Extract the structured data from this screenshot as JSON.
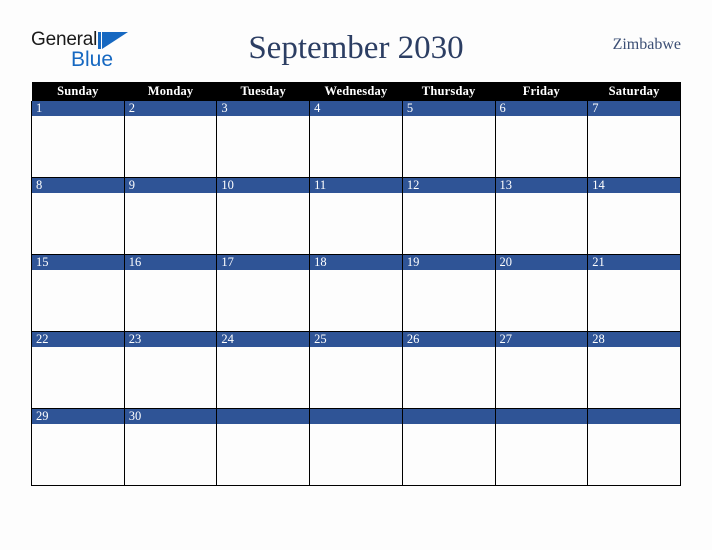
{
  "brand": {
    "name_part1": "General",
    "name_part2": "Blue",
    "triangle_icon": "triangle-right-icon",
    "accent_color": "#1668c1"
  },
  "header": {
    "title": "September 2030",
    "country": "Zimbabwe",
    "title_color": "#2c3e63",
    "country_color": "#3c4f75"
  },
  "calendar": {
    "month": "September",
    "year": "2030",
    "header_bg": "#000000",
    "header_fg": "#ffffff",
    "daynum_bg": "#2f5496",
    "daynum_fg": "#ffffff",
    "cell_bg": "#fdfdfd",
    "border_color": "#000000",
    "weekday_headers": [
      "Sunday",
      "Monday",
      "Tuesday",
      "Wednesday",
      "Thursday",
      "Friday",
      "Saturday"
    ],
    "weeks": [
      [
        {
          "day": "1"
        },
        {
          "day": "2"
        },
        {
          "day": "3"
        },
        {
          "day": "4"
        },
        {
          "day": "5"
        },
        {
          "day": "6"
        },
        {
          "day": "7"
        }
      ],
      [
        {
          "day": "8"
        },
        {
          "day": "9"
        },
        {
          "day": "10"
        },
        {
          "day": "11"
        },
        {
          "day": "12"
        },
        {
          "day": "13"
        },
        {
          "day": "14"
        }
      ],
      [
        {
          "day": "15"
        },
        {
          "day": "16"
        },
        {
          "day": "17"
        },
        {
          "day": "18"
        },
        {
          "day": "19"
        },
        {
          "day": "20"
        },
        {
          "day": "21"
        }
      ],
      [
        {
          "day": "22"
        },
        {
          "day": "23"
        },
        {
          "day": "24"
        },
        {
          "day": "25"
        },
        {
          "day": "26"
        },
        {
          "day": "27"
        },
        {
          "day": "28"
        }
      ],
      [
        {
          "day": "29"
        },
        {
          "day": "30"
        },
        {
          "day": ""
        },
        {
          "day": ""
        },
        {
          "day": ""
        },
        {
          "day": ""
        },
        {
          "day": ""
        }
      ]
    ]
  }
}
